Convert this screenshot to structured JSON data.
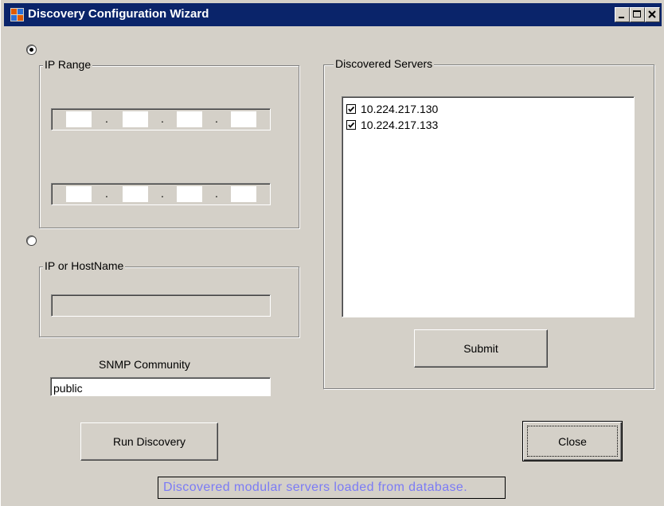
{
  "window": {
    "title": "Discovery Configuration Wizard",
    "controls": [
      "minimize",
      "maximize",
      "close"
    ]
  },
  "mode": {
    "ip_range_selected": true,
    "hostname_selected": false
  },
  "ip_range": {
    "label": "IP Range",
    "start": [
      "",
      "",
      "",
      ""
    ],
    "end": [
      "",
      "",
      "",
      ""
    ],
    "separator": "."
  },
  "hostname": {
    "label": "IP or HostName",
    "value": ""
  },
  "snmp": {
    "label": "SNMP Community",
    "value": "public"
  },
  "run_button": "Run Discovery",
  "discovered": {
    "label": "Discovered Servers",
    "items": [
      {
        "checked": true,
        "address": "10.224.217.130"
      },
      {
        "checked": true,
        "address": "10.224.217.133"
      }
    ],
    "submit_button": "Submit"
  },
  "close_button": "Close",
  "status": "Discovered modular servers loaded from database."
}
